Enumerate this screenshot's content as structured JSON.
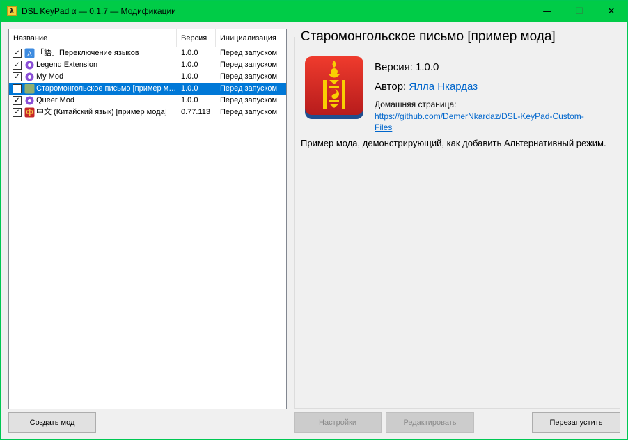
{
  "window": {
    "title": "DSL KeyPad α — 0.1.7 — Модификации",
    "app_icon_glyph": "λ",
    "controls": {
      "minimize": "—",
      "maximize": "☐",
      "close": "✕"
    }
  },
  "list": {
    "columns": {
      "name": "Название",
      "version": "Версия",
      "init": "Инициализация"
    },
    "rows": [
      {
        "checked": true,
        "icon": "language-switch-icon",
        "name": "「語」Переключение языков",
        "version": "1.0.0",
        "init": "Перед запуском"
      },
      {
        "checked": true,
        "icon": "gear-icon",
        "name": "Legend Extension",
        "version": "1.0.0",
        "init": "Перед запуском"
      },
      {
        "checked": true,
        "icon": "gear-icon",
        "name": "My Mod",
        "version": "1.0.0",
        "init": "Перед запуском"
      },
      {
        "checked": false,
        "icon": "mongolian-emblem-icon",
        "name": "Старомонгольское письмо [пример мода]",
        "version": "1.0.0",
        "init": "Перед запуском",
        "selected": true
      },
      {
        "checked": true,
        "icon": "gear-icon",
        "name": "Queer Mod",
        "version": "1.0.0",
        "init": "Перед запуском"
      },
      {
        "checked": true,
        "icon": "chinese-character-icon",
        "name": "中文 (Китайский язык) [пример мода]",
        "version": "0.77.113",
        "init": "Перед запуском"
      }
    ]
  },
  "details": {
    "title": "Старомонгольское письмо [пример мода]",
    "version_line": "Версия: 1.0.0",
    "author_label": "Автор: ",
    "author_name": "Ялла Нкардаз",
    "homepage_label": "Домашняя страница:",
    "homepage_url_line1": "https://github.com/DemerNkardaz/DSL-KeyPad-Custom-",
    "homepage_url_line2": "Files",
    "description": "Пример мода, демонстрирующий, как добавить Альтернативный режим.",
    "icon": "mongolian-soyombo-icon"
  },
  "buttons": {
    "create": "Создать мод",
    "settings": "Настройки",
    "edit": "Редактировать",
    "restart": "Перезапустить"
  },
  "colors": {
    "titlebar": "#00cc47",
    "selection": "#0078d7",
    "link": "#0066cc",
    "mongol_red": "#d52b1e",
    "mongol_gold": "#f9cf02"
  }
}
